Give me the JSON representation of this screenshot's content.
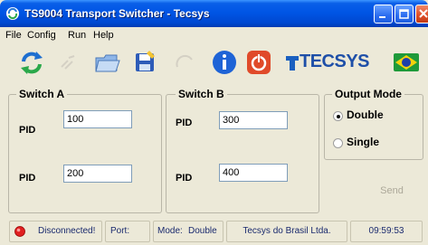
{
  "window": {
    "title": "TS9004 Transport Switcher - Tecsys"
  },
  "menu": [
    "File",
    "Config",
    "Run",
    "Help"
  ],
  "toolbar": {
    "icons": [
      "refresh-icon",
      "disabled-tool-icon",
      "open-folder-icon",
      "save-icon",
      "disabled-undo-icon",
      "info-icon",
      "power-icon",
      "tecsys-logo",
      "brazil-flag-icon"
    ],
    "logo_text": "TECSYS"
  },
  "switch_a": {
    "title": "Switch A",
    "pid1_label": "PID",
    "pid1_value": "100",
    "pid2_label": "PID",
    "pid2_value": "200"
  },
  "switch_b": {
    "title": "Switch B",
    "pid1_label": "PID",
    "pid1_value": "300",
    "pid2_label": "PID",
    "pid2_value": "400"
  },
  "output_mode": {
    "title": "Output Mode",
    "options": [
      "Double",
      "Single"
    ],
    "selected": "Double"
  },
  "send_label": "Send",
  "status": {
    "connection": "Disconnected!",
    "port_label": "Port:",
    "port_value": "",
    "mode_label": "Mode:",
    "mode_value": "Double",
    "company": "Tecsys do Brasil Ltda.",
    "time": "09:59:53",
    "connection_color": "#e02020"
  },
  "colors": {
    "titlebar": "#0055e5",
    "accent_red": "#e04a2a",
    "info_blue": "#1e63d6"
  }
}
